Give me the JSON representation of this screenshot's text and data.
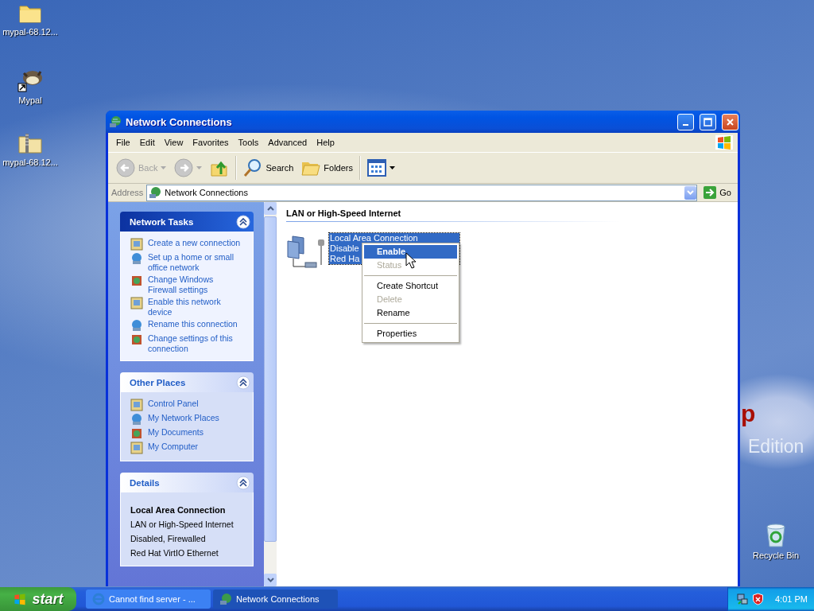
{
  "desktop": {
    "icons": [
      {
        "label": "mypal-68.12...",
        "kind": "folder"
      },
      {
        "label": "Mypal",
        "kind": "shortcut"
      },
      {
        "label": "mypal-68.12...",
        "kind": "zip"
      },
      {
        "label": "Recycle Bin",
        "kind": "recycle"
      }
    ],
    "wallpaper_logo": "p",
    "wallpaper_text": "Edition"
  },
  "window": {
    "title": "Network Connections",
    "menu": [
      "File",
      "Edit",
      "View",
      "Favorites",
      "Tools",
      "Advanced",
      "Help"
    ],
    "toolbar": [
      {
        "kind": "back",
        "label": "Back",
        "disabled": true
      },
      {
        "kind": "forward",
        "disabled": true
      },
      {
        "kind": "up",
        "disabled": false
      },
      {
        "kind": "search",
        "label": "Search",
        "disabled": false
      },
      {
        "kind": "folders",
        "label": "Folders",
        "disabled": false
      },
      {
        "kind": "views",
        "disabled": false
      }
    ],
    "address": {
      "label": "Address",
      "value": "Network Connections",
      "go": "Go"
    },
    "sidebar": {
      "panels": [
        {
          "title": "Network Tasks",
          "kind": "special",
          "expanded": true,
          "items": [
            {
              "label": "Create a new connection",
              "kind": "link"
            },
            {
              "label": "Set up a home or small office network",
              "kind": "link"
            },
            {
              "label": "Change Windows Firewall settings",
              "kind": "link"
            },
            {
              "label": "Enable this network device",
              "kind": "link"
            },
            {
              "label": "Rename this connection",
              "kind": "link"
            },
            {
              "label": "Change settings of this connection",
              "kind": "link"
            }
          ]
        },
        {
          "title": "Other Places",
          "kind": "normal",
          "expanded": true,
          "items": [
            {
              "label": "Control Panel",
              "kind": "link"
            },
            {
              "label": "My Network Places",
              "kind": "link"
            },
            {
              "label": "My Documents",
              "kind": "link"
            },
            {
              "label": "My Computer",
              "kind": "link"
            }
          ]
        },
        {
          "title": "Details",
          "kind": "normal",
          "expanded": true,
          "items": [
            {
              "label": "Local Area Connection",
              "kind": "heading"
            },
            {
              "label": "LAN or High-Speed Internet",
              "kind": "text"
            },
            {
              "label": "Disabled, Firewalled",
              "kind": "text"
            },
            {
              "label": "Red Hat VirtIO Ethernet",
              "kind": "text"
            }
          ]
        }
      ]
    },
    "group_heading": "LAN or High-Speed Internet",
    "connection": {
      "lines": [
        "Local Area Connection",
        "Disable",
        "Red Ha"
      ],
      "selected": true
    },
    "context_menu": [
      {
        "kind": "item",
        "label": "Enable",
        "default": true,
        "selected": true,
        "disabled": false
      },
      {
        "kind": "item",
        "label": "Status",
        "default": false,
        "selected": false,
        "disabled": true
      },
      {
        "kind": "separator"
      },
      {
        "kind": "item",
        "label": "Create Shortcut",
        "default": false,
        "selected": false,
        "disabled": false
      },
      {
        "kind": "item",
        "label": "Delete",
        "default": false,
        "selected": false,
        "disabled": true
      },
      {
        "kind": "item",
        "label": "Rename",
        "default": false,
        "selected": false,
        "disabled": false
      },
      {
        "kind": "separator"
      },
      {
        "kind": "item",
        "label": "Properties",
        "default": false,
        "selected": false,
        "disabled": false
      }
    ]
  },
  "taskbar": {
    "start": "start",
    "tasks": [
      {
        "label": "Cannot find server - ...",
        "kind": "browser",
        "selected": false
      },
      {
        "label": "Network Connections",
        "kind": "network",
        "selected": true
      }
    ],
    "clock": "4:01 PM"
  }
}
